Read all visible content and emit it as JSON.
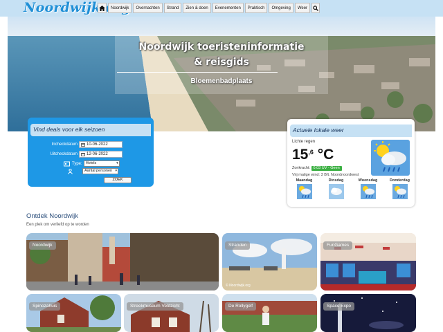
{
  "site": {
    "logo": "Noordwijk.org"
  },
  "nav": {
    "items": [
      "Noordwijk",
      "Overnachten",
      "Strand",
      "Zien & doen",
      "Evenementen",
      "Praktisch",
      "Omgeving",
      "Weer"
    ]
  },
  "hero": {
    "title_line1": "Noordwijk toeristeninformatie",
    "title_line2": "& reisgids",
    "subtitle": "Bloemenbadplaats"
  },
  "deals": {
    "title": "Vind deals voor elk seizoen",
    "checkin_label": "Incheckdatum",
    "checkin_value": "10-06-2022",
    "checkout_label": "Uitcheckdatum",
    "checkout_value": "12-06-2022",
    "type_label": "Type:",
    "type_value": "Hotels",
    "persons_value": "Aantal personen",
    "submit_label": "ZOEK"
  },
  "weather": {
    "title": "Actuele lokale weer",
    "condition": "Lichte regen",
    "temp_int": "15",
    "temp_dec": ",6",
    "temp_unit": " °C",
    "zon_label": "Zonkracht:",
    "zon_value": "0.03 UV - Geen",
    "wind": "Vrij matige wind: 3 Bft. Noordnoordwest",
    "days": [
      {
        "name": "Maandag",
        "icon": "rain-cloud-icon"
      },
      {
        "name": "Dinsdag",
        "icon": "cloud-icon"
      },
      {
        "name": "Woensdag",
        "icon": "rain-cloud-icon"
      },
      {
        "name": "Donderdag",
        "icon": "rain-cloud-icon"
      }
    ]
  },
  "discover": {
    "title": "Ontdek Noordwijk",
    "subtitle": "Een plek om verliefd op te worden",
    "tiles": [
      {
        "label": "Noordwijk"
      },
      {
        "label": "Stranden",
        "credit": "© Noordwijk.org"
      },
      {
        "label": "FunGames"
      },
      {
        "label": "Spinozahuis"
      },
      {
        "label": "Streekmuseum Veldzicht"
      },
      {
        "label": "De Rollygolf"
      },
      {
        "label": "Space Expo"
      }
    ]
  },
  "colors": {
    "accent": "#1e98e6",
    "header_bg": "#c6e1f4",
    "badge_green": "#3cb043"
  }
}
